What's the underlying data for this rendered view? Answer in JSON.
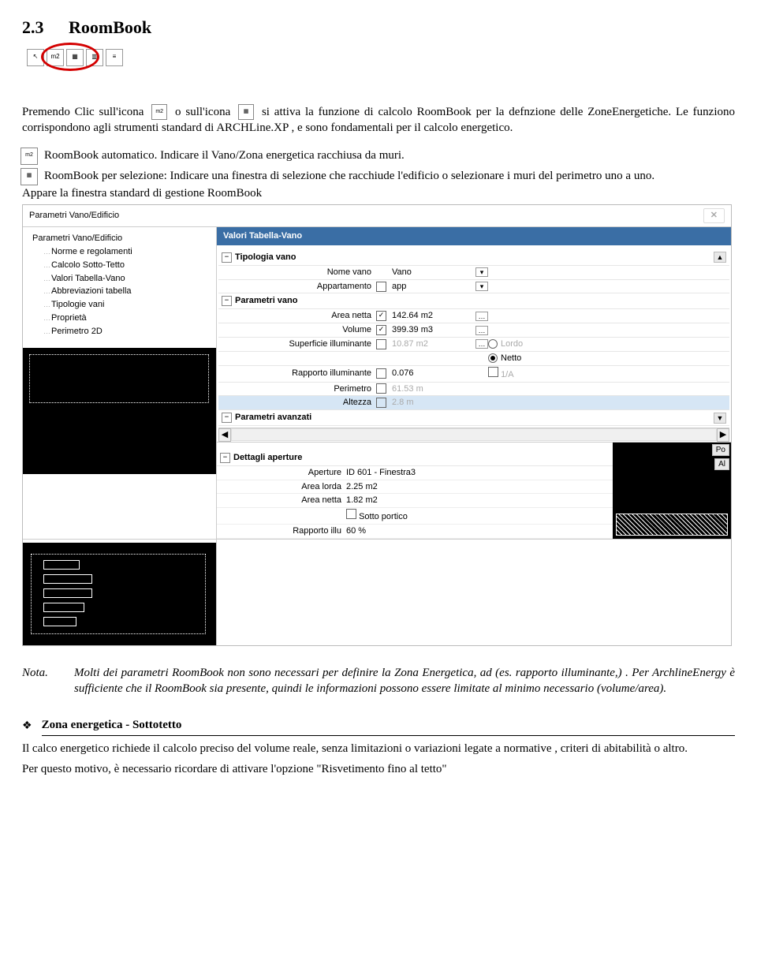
{
  "heading": {
    "number": "2.3",
    "title": "RoomBook"
  },
  "toolbar_icons": [
    "cursor-icon",
    "m2-icon",
    "grid-icon",
    "brick-icon",
    "bars-icon"
  ],
  "para1": {
    "t1": "Premendo Clic sull'icona ",
    "t2": " o sull'icona ",
    "t3": " si attiva la funzione di calcolo RoomBook per la defnzione delle ZoneEnergetiche. Le funziono corrispondono agli strumenti standard di ARCHLine.XP , e sono fondamentali per il calcolo energetico."
  },
  "bullet1": "RoomBook automatico. Indicare il Vano/Zona energetica racchiusa da muri.",
  "bullet2": "RoomBook per selezione: Indicare una finestra di selezione che racchiude l'edificio o selezionare i muri del perimetro uno a uno.",
  "para2": "Appare la finestra standard di gestione RoomBook",
  "app": {
    "title": "Parametri Vano/Edificio",
    "close": "✕",
    "tree": [
      "Parametri Vano/Edificio",
      "Norme e regolamenti",
      "Calcolo Sotto-Tetto",
      "Valori Tabella-Vano",
      "Abbreviazioni tabella",
      "Tipologie vani",
      "Proprietà",
      "Perimetro 2D"
    ],
    "right_header": "Valori Tabella-Vano",
    "groups": {
      "tipologia": "Tipologia vano",
      "parametri": "Parametri vano",
      "avanzati": "Parametri avanzati",
      "dettagli": "Dettagli aperture"
    },
    "rows": {
      "nome_vano": {
        "label": "Nome vano",
        "value": "Vano"
      },
      "appartamento": {
        "label": "Appartamento",
        "value": "app",
        "checked": false
      },
      "area_netta": {
        "label": "Area netta",
        "value": "142.64 m2",
        "checked": true
      },
      "volume": {
        "label": "Volume",
        "value": "399.39 m3",
        "checked": true
      },
      "sup_illum": {
        "label": "Superficie illuminante",
        "value": "10.87 m2",
        "checked": false
      },
      "rapporto": {
        "label": "Rapporto illuminante",
        "value": "0.076",
        "checked": false
      },
      "perimetro": {
        "label": "Perimetro",
        "value": "61.53 m",
        "checked": false
      },
      "altezza": {
        "label": "Altezza",
        "value": "2.8 m",
        "checked": false
      }
    },
    "radios": {
      "lordo": "Lordo",
      "netto": "Netto",
      "one_a": "1/A"
    },
    "details": {
      "aperture": {
        "label": "Aperture",
        "value": "ID 601 - Finestra3"
      },
      "area_lorda": {
        "label": "Area lorda",
        "value": "2.25 m2"
      },
      "area_netta": {
        "label": "Area netta",
        "value": "1.82 m2"
      },
      "sotto_portico": {
        "label": "Sotto portico",
        "checked": false
      },
      "rapporto_illu": {
        "label": "Rapporto illu",
        "value": "60 %"
      }
    },
    "side_btn_top": "Po",
    "side_btn_bot": "Al"
  },
  "note": {
    "label": "Nota.",
    "body": "Molti dei parametri RoomBook non sono necessari per definire la Zona Energetica, ad (es. rapporto illuminante,) . Per ArchlineEnergy è sufficiente che il RoomBook sia presente, quindi le informazioni possono essere limitate al minimo necessario (volume/area)."
  },
  "zone": {
    "bullet": "❖",
    "title": "Zona energetica - Sottotetto",
    "p1": "Il calco energetico richiede il calcolo preciso del volume reale, senza limitazioni o variazioni legate a normative , criteri di abitabilità o altro.",
    "p2": "Per questo motivo, è necessario ricordare di attivare l'opzione \"Risvetimento fino al tetto\""
  }
}
